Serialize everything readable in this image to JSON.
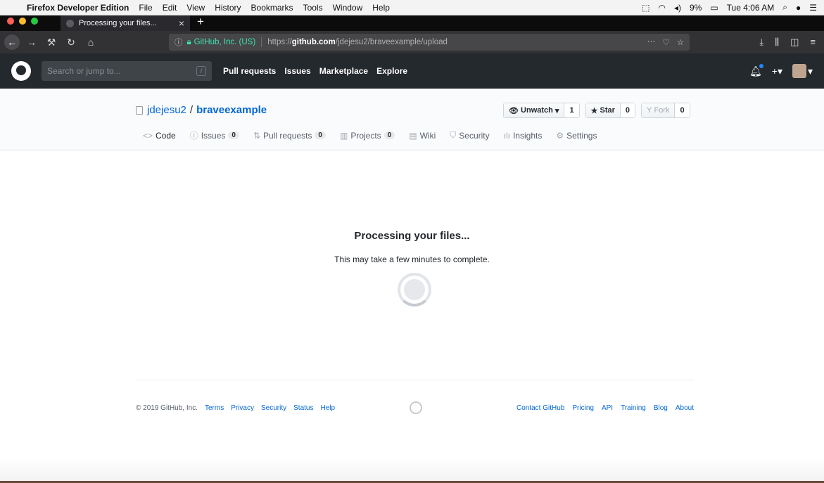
{
  "os_menubar": {
    "app_name": "Firefox Developer Edition",
    "menus": [
      "File",
      "Edit",
      "View",
      "History",
      "Bookmarks",
      "Tools",
      "Window",
      "Help"
    ],
    "battery": "9%",
    "clock": "Tue 4:06 AM"
  },
  "browser": {
    "tab_title": "Processing your files...",
    "identity_org": "GitHub, Inc. (US)",
    "url_prefix": "https://",
    "url_host": "github.com",
    "url_path": "/jdejesu2/braveexample/upload"
  },
  "github_header": {
    "search_placeholder": "Search or jump to...",
    "search_key": "/",
    "nav": [
      "Pull requests",
      "Issues",
      "Marketplace",
      "Explore"
    ]
  },
  "repo": {
    "owner": "jdejesu2",
    "name": "braveexample",
    "watch_label": "Unwatch",
    "watch_count": "1",
    "star_label": "Star",
    "star_count": "0",
    "fork_label": "Fork",
    "fork_count": "0",
    "tabs": [
      {
        "label": "Code"
      },
      {
        "label": "Issues",
        "count": "0"
      },
      {
        "label": "Pull requests",
        "count": "0"
      },
      {
        "label": "Projects",
        "count": "0"
      },
      {
        "label": "Wiki"
      },
      {
        "label": "Security"
      },
      {
        "label": "Insights"
      },
      {
        "label": "Settings"
      }
    ]
  },
  "main": {
    "title": "Processing your files...",
    "subtitle": "This may take a few minutes to complete."
  },
  "footer": {
    "copyright": "© 2019 GitHub, Inc.",
    "left_links": [
      "Terms",
      "Privacy",
      "Security",
      "Status",
      "Help"
    ],
    "right_links": [
      "Contact GitHub",
      "Pricing",
      "API",
      "Training",
      "Blog",
      "About"
    ]
  }
}
